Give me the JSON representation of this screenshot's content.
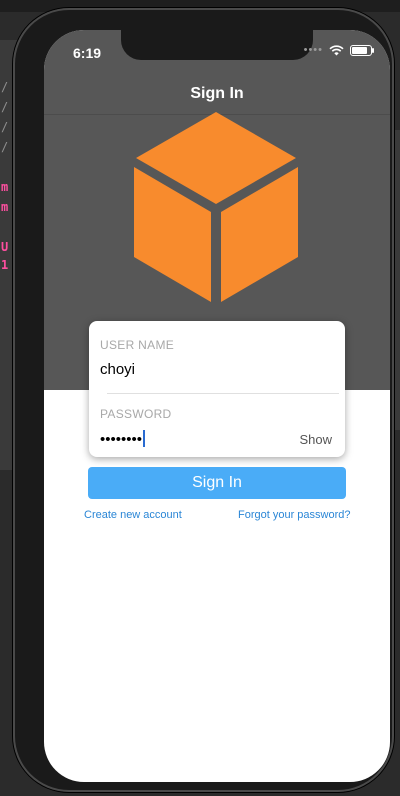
{
  "status_bar": {
    "time": "6:19",
    "battery_level": 0.85
  },
  "nav": {
    "title": "Sign In"
  },
  "logo": {
    "icon": "cube-icon",
    "color": "#f88b2d"
  },
  "form": {
    "username_label": "USER NAME",
    "username_value": "choyi",
    "password_label": "PASSWORD",
    "password_value": "••••••••",
    "show_label": "Show"
  },
  "actions": {
    "sign_in_label": "Sign In",
    "create_account_label": "Create new account",
    "forgot_password_label": "Forgot your password?"
  },
  "background": {
    "left_glyphs": [
      "/",
      "/",
      "/",
      "/",
      "m",
      "m",
      "U",
      "1"
    ]
  },
  "colors": {
    "header_bg": "#575757",
    "accent": "#4aacf7",
    "link": "#2a86d6",
    "logo": "#f88b2d"
  }
}
